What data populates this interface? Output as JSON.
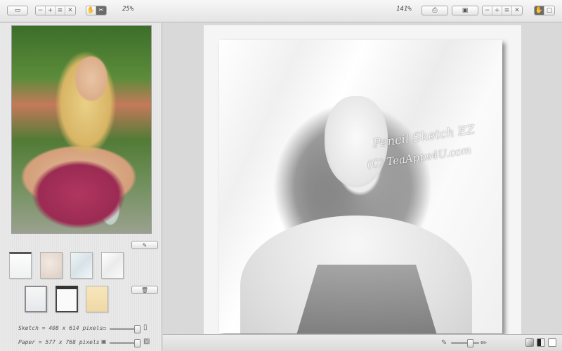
{
  "toolbar": {
    "zoom_left": "25%",
    "zoom_right": "141%"
  },
  "sketch_info": {
    "sketch_size": "Sketch = 408 x 614 pixels",
    "paper_size": "Paper = 577 x 768 pixels"
  },
  "watermark": {
    "line1": "Pencil Sketch EZ",
    "line2": "(C) TeaApps4U.com"
  }
}
